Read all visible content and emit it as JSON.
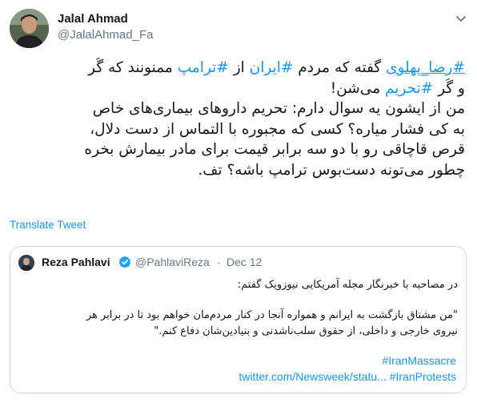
{
  "author": {
    "name": "Jalal Ahmad",
    "handle": "@JalalAhmad_Fa"
  },
  "tweet": {
    "line1_tag1": "#رضا_پهلوی",
    "line1_t1": " گفته که مردم ",
    "line1_tag2": "#ایران",
    "line1_t2": " از ",
    "line1_tag3": "#ترامپ",
    "line1_t3": " ممنونند که گُر",
    "line2_t1": "و گُر ",
    "line2_tag1": "#تحریم",
    "line2_t2": " می‌شن!",
    "line3": "من از ایشون یه سوال دارم: تحریم داروهای بیماری‌های خاص",
    "line4": "به کی فشار میاره؟ کسی که مجبوره با التماس از دست دلال،",
    "line5": "قرص قاچاقی رو با دو سه برابر قیمت برای مادر بیمارش بخره",
    "line6": "چطور می‌تونه دست‌بوس ترامپ باشه؟ تف."
  },
  "translate_label": "Translate Tweet",
  "quoted": {
    "name": "Reza Pahlavi",
    "handle": "@PahlaviReza",
    "separator": "·",
    "date": "Dec 12",
    "line1": "در مصاحبه با خبرنگار مجله آمریکایی نیوزویک گفتم:",
    "line2": "\"من مشتاق بازگشت به ایرانم و همواره آنجا در کنار مردم‌مان خواهم بود تا در برابر هر",
    "line3": "نیروی خارجی و داخلی، از حقوق سلب‌ناشدنی و بنیادین‌شان دفاع کنم.\"",
    "hashtag1": "#IranMassacre",
    "link": "twitter.com/Newsweek/statu...",
    "hashtag2": "#IranProtests"
  },
  "colors": {
    "link_blue": "#1b95e0",
    "text": "#14171a",
    "muted": "#657786",
    "border": "#ccd6dd",
    "verified": "#1da1f2"
  },
  "icons": [
    "avatar",
    "chevron-down-icon",
    "verified-badge-icon"
  ]
}
